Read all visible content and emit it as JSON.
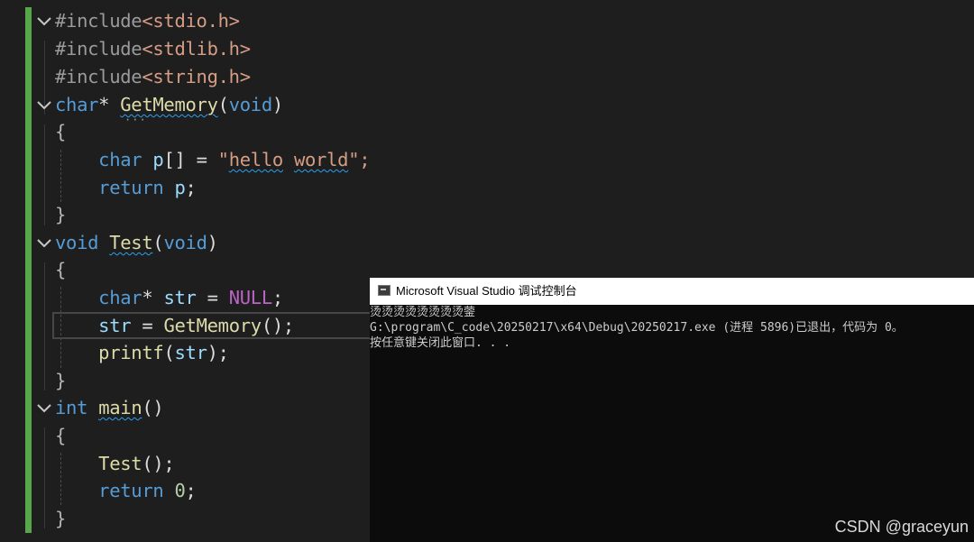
{
  "editor": {
    "lines": [
      [
        [
          "#include",
          "pre"
        ],
        [
          "<stdio.h>",
          "inc"
        ]
      ],
      [
        [
          "#include",
          "pre"
        ],
        [
          "<stdlib.h>",
          "inc"
        ]
      ],
      [
        [
          "#include",
          "pre"
        ],
        [
          "<string.h>",
          "inc"
        ]
      ],
      [
        [
          "char",
          "kw"
        ],
        [
          "* ",
          "def"
        ],
        [
          "GetMemory",
          "fnsq"
        ],
        [
          "(",
          "def"
        ],
        [
          "void",
          "kw"
        ],
        [
          ")",
          "def"
        ]
      ],
      [
        [
          "{",
          "mut"
        ]
      ],
      [
        [
          "    ",
          "def"
        ],
        [
          "char",
          "kw"
        ],
        [
          " ",
          "def"
        ],
        [
          "p",
          "var"
        ],
        [
          "[] = ",
          "def"
        ],
        [
          "\"",
          "str"
        ],
        [
          "hello",
          "strsq"
        ],
        [
          " ",
          "str"
        ],
        [
          "world",
          "strsq"
        ],
        [
          "\";",
          "str"
        ]
      ],
      [
        [
          "    ",
          "def"
        ],
        [
          "return",
          "kw"
        ],
        [
          " ",
          "def"
        ],
        [
          "p",
          "var"
        ],
        [
          ";",
          "def"
        ]
      ],
      [
        [
          "}",
          "mut"
        ]
      ],
      [
        [
          "void",
          "kw"
        ],
        [
          " ",
          "def"
        ],
        [
          "Test",
          "fnsq"
        ],
        [
          "(",
          "def"
        ],
        [
          "void",
          "kw"
        ],
        [
          ")",
          "def"
        ]
      ],
      [
        [
          "{",
          "mut"
        ]
      ],
      [
        [
          "    ",
          "def"
        ],
        [
          "char",
          "kw"
        ],
        [
          "* ",
          "def"
        ],
        [
          "str",
          "var"
        ],
        [
          " = ",
          "def"
        ],
        [
          "NULL",
          "mac"
        ],
        [
          ";",
          "def"
        ]
      ],
      [
        [
          "    ",
          "def"
        ],
        [
          "str",
          "var"
        ],
        [
          " = ",
          "def"
        ],
        [
          "GetMemory",
          "fn"
        ],
        [
          "();",
          "def"
        ]
      ],
      [
        [
          "    ",
          "def"
        ],
        [
          "printf",
          "fn"
        ],
        [
          "(",
          "def"
        ],
        [
          "str",
          "var"
        ],
        [
          ");",
          "def"
        ]
      ],
      [
        [
          "}",
          "mut"
        ]
      ],
      [
        [
          "int",
          "kw"
        ],
        [
          " ",
          "def"
        ],
        [
          "main",
          "fnsq"
        ],
        [
          "()",
          "def"
        ]
      ],
      [
        [
          "{",
          "mut"
        ]
      ],
      [
        [
          "    ",
          "def"
        ],
        [
          "Test",
          "fn"
        ],
        [
          "();",
          "def"
        ]
      ],
      [
        [
          "    ",
          "def"
        ],
        [
          "return",
          "kw"
        ],
        [
          " ",
          "def"
        ],
        [
          "0",
          "num"
        ],
        [
          ";",
          "def"
        ]
      ],
      [
        [
          "}",
          "mut"
        ]
      ]
    ]
  },
  "console": {
    "title": "Microsoft Visual Studio 调试控制台",
    "lines": [
      "烫烫烫烫烫烫烫烫蓥",
      "G:\\program\\C_code\\20250217\\x64\\Debug\\20250217.exe (进程 5896)已退出，代码为 0。",
      "按任意键关闭此窗口. . ."
    ]
  },
  "watermark": "CSDN @graceyun",
  "colors": {
    "background": "#1e1e1e",
    "keyword": "#569cd6",
    "function": "#dcdcaa",
    "variable": "#9cdcfe",
    "string": "#d69d85",
    "macro": "#bd63c5",
    "number": "#b5cea8",
    "gutter_change": "#57a64a"
  }
}
